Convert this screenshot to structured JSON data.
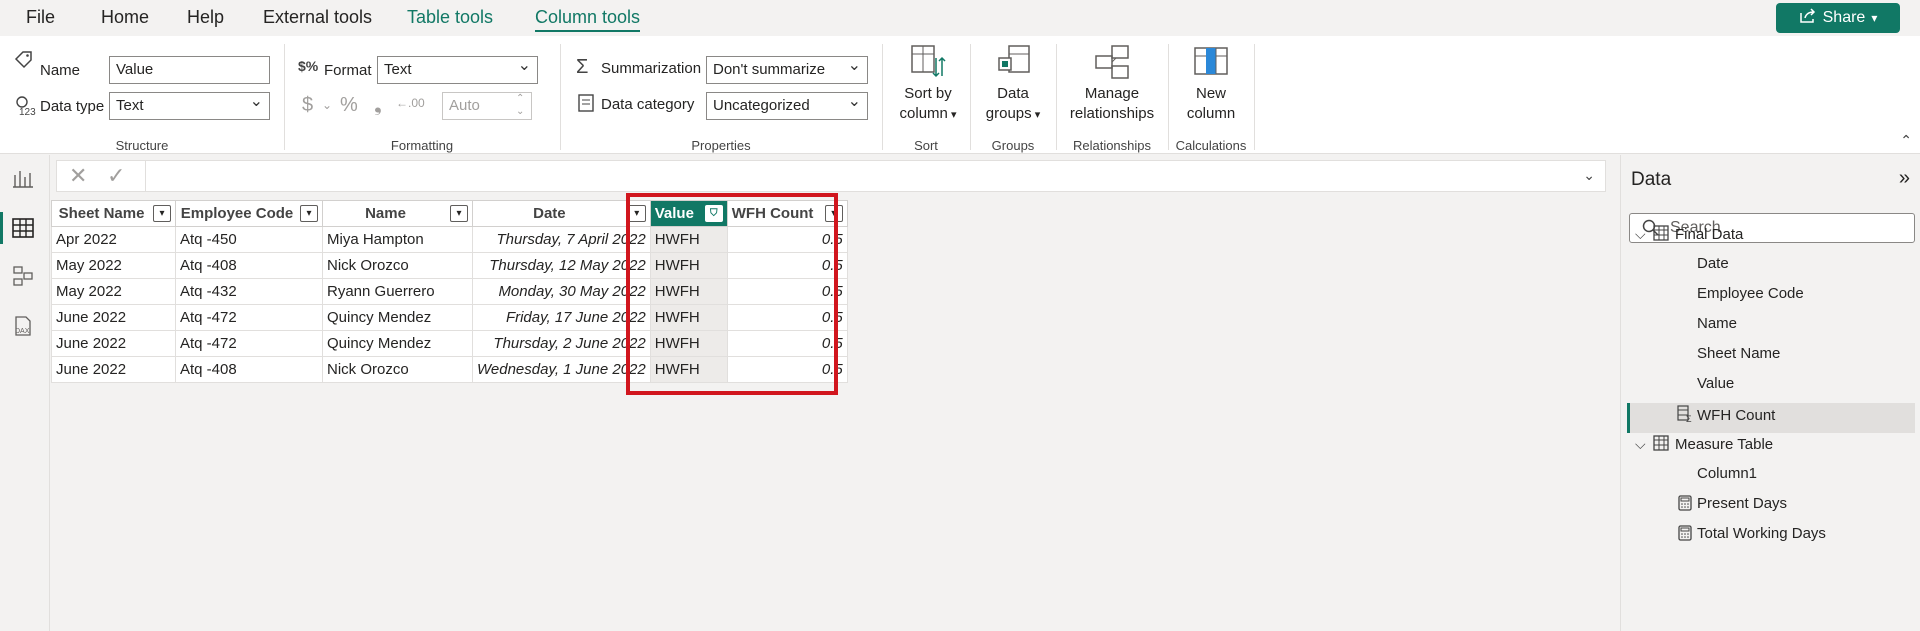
{
  "menubar": {
    "items": [
      "File",
      "Home",
      "Help",
      "External tools",
      "Table tools",
      "Column tools"
    ],
    "share_label": "Share"
  },
  "ribbon": {
    "structure": {
      "name_label": "Name",
      "name_value": "Value",
      "datatype_label": "Data type",
      "datatype_value": "Text",
      "group_label": "Structure"
    },
    "formatting": {
      "format_label": "Format",
      "format_value": "Text",
      "decimal_placeholder": "Auto",
      "group_label": "Formatting"
    },
    "properties": {
      "summarization_label": "Summarization",
      "summarization_value": "Don't summarize",
      "category_label": "Data category",
      "category_value": "Uncategorized",
      "group_label": "Properties"
    },
    "sort": {
      "button_line1": "Sort by",
      "button_line2": "column",
      "group_label": "Sort"
    },
    "groups": {
      "button_line1": "Data",
      "button_line2": "groups",
      "group_label": "Groups"
    },
    "relationships": {
      "button_line1": "Manage",
      "button_line2": "relationships",
      "group_label": "Relationships"
    },
    "calculations": {
      "button_line1": "New",
      "button_line2": "column",
      "group_label": "Calculations"
    }
  },
  "table": {
    "columns": [
      "Sheet Name",
      "Employee Code",
      "Name",
      "Date",
      "Value",
      "WFH Count"
    ],
    "selected_column": "Value",
    "rows": [
      [
        "Apr 2022",
        "Atq -450",
        "Miya Hampton",
        "Thursday, 7 April 2022",
        "HWFH",
        "0.5"
      ],
      [
        "May 2022",
        "Atq -408",
        "Nick Orozco",
        "Thursday, 12 May 2022",
        "HWFH",
        "0.5"
      ],
      [
        "May 2022",
        "Atq -432",
        "Ryann Guerrero",
        "Monday, 30 May 2022",
        "HWFH",
        "0.5"
      ],
      [
        "June 2022",
        "Atq -472",
        "Quincy Mendez",
        "Friday, 17 June 2022",
        "HWFH",
        "0.5"
      ],
      [
        "June 2022",
        "Atq -472",
        "Quincy Mendez",
        "Thursday, 2 June 2022",
        "HWFH",
        "0.5"
      ],
      [
        "June 2022",
        "Atq -408",
        "Nick Orozco",
        "Wednesday, 1 June 2022",
        "HWFH",
        "0.5"
      ]
    ]
  },
  "datapane": {
    "title": "Data",
    "search_placeholder": "Search",
    "tree": [
      {
        "label": "Final Data",
        "kind": "table"
      },
      {
        "label": "Date",
        "kind": "field"
      },
      {
        "label": "Employee Code",
        "kind": "field"
      },
      {
        "label": "Name",
        "kind": "field"
      },
      {
        "label": "Sheet Name",
        "kind": "field"
      },
      {
        "label": "Value",
        "kind": "field",
        "selected": true
      },
      {
        "label": "WFH Count",
        "kind": "calc-field"
      },
      {
        "label": "Measure Table",
        "kind": "table"
      },
      {
        "label": "Column1",
        "kind": "field"
      },
      {
        "label": "Present Days",
        "kind": "measure"
      },
      {
        "label": "Total Working Days",
        "kind": "measure"
      }
    ]
  },
  "colors": {
    "accent": "#117865",
    "highlight": "#d1161e"
  }
}
